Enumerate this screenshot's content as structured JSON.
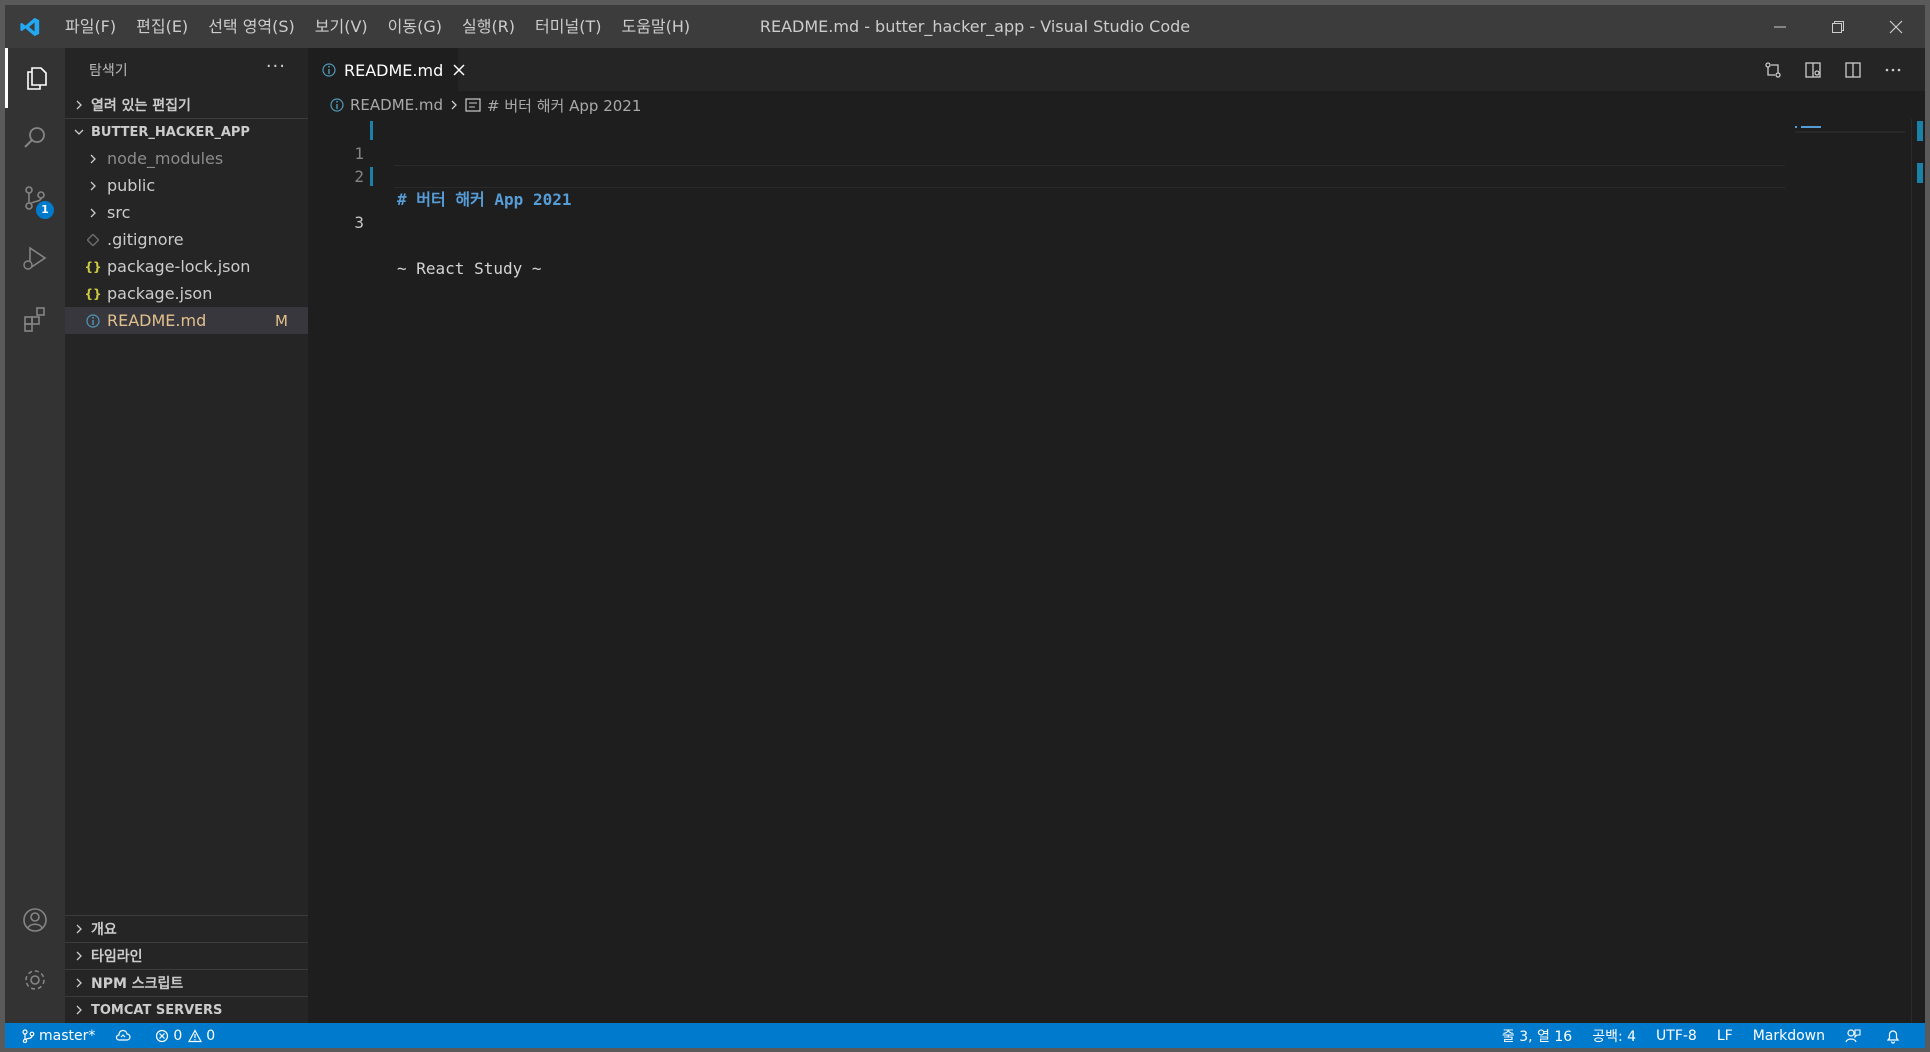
{
  "titlebar": {
    "menus": [
      "파일(F)",
      "편집(E)",
      "선택 영역(S)",
      "보기(V)",
      "이동(G)",
      "실행(R)",
      "터미널(T)",
      "도움말(H)"
    ],
    "window_title": "README.md - butter_hacker_app - Visual Studio Code"
  },
  "activitybar": {
    "items": [
      "explorer-icon",
      "search-icon",
      "source-control-icon",
      "run-debug-icon",
      "extensions-icon"
    ],
    "source_control_badge": "1",
    "bottom": [
      "account-icon",
      "settings-gear-icon"
    ]
  },
  "sidebar": {
    "title": "탐색기",
    "more": "···",
    "open_editors": "열려 있는 편집기",
    "project": "BUTTER_HACKER_APP",
    "tree": [
      {
        "label": "node_modules",
        "kind": "folder"
      },
      {
        "label": "public",
        "kind": "folder"
      },
      {
        "label": "src",
        "kind": "folder"
      },
      {
        "label": ".gitignore",
        "kind": "git"
      },
      {
        "label": "package-lock.json",
        "kind": "json"
      },
      {
        "label": "package.json",
        "kind": "json"
      },
      {
        "label": "README.md",
        "kind": "info",
        "badge": "M"
      }
    ],
    "bottom_sections": [
      "개요",
      "타임라인",
      "NPM 스크립트",
      "TOMCAT SERVERS"
    ]
  },
  "editor": {
    "tab_label": "README.md",
    "breadcrumb": {
      "file": "README.md",
      "symbol": "# 버터 해커 App 2021"
    },
    "lines": [
      {
        "n": "1",
        "text": "# 버터 해커 App 2021"
      },
      {
        "n": "2",
        "text": ""
      },
      {
        "n": "3",
        "text": "~ React Study ~"
      }
    ]
  },
  "statusbar": {
    "branch": "master*",
    "errors": "0",
    "warnings": "0",
    "position": "줄 3, 열 16",
    "spaces": "공백: 4",
    "encoding": "UTF-8",
    "eol": "LF",
    "language": "Markdown"
  },
  "colors": {
    "statusbar": "#007acc",
    "activitybar": "#333333",
    "sidebar": "#252526",
    "editor": "#1e1e1e",
    "heading": "#569cd6",
    "modified": "#e2c08d"
  }
}
